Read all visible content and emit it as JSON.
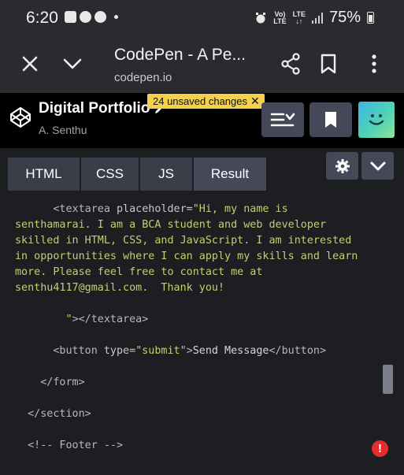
{
  "status_bar": {
    "time": "6:20",
    "network_top": "Vo)",
    "network_bottom": "LTE",
    "lte_top": "LTE",
    "lte_bottom": "↓↑",
    "battery": "75%",
    "left_icons": [
      "image-icon",
      "media-icon",
      "game-icon"
    ],
    "right_icons": [
      "alarm-icon",
      "signal-icon",
      "battery-icon"
    ]
  },
  "browser": {
    "title": "CodePen - A Pe...",
    "url": "codepen.io",
    "icons": [
      "close-icon",
      "chevron-down-icon",
      "share-icon",
      "bookmark-icon",
      "more-vert-icon"
    ]
  },
  "codepen": {
    "title": "Digital Portfolio",
    "author": "A. Senthu",
    "unsaved_badge": "24 unsaved changes",
    "unsaved_close": "✕",
    "icons": [
      "codepen-logo-icon",
      "edit-pencil-icon",
      "layout-icon",
      "bookmark-icon",
      "avatar-face-icon"
    ],
    "accent": "#f5d04a"
  },
  "tabs": [
    "HTML",
    "CSS",
    "JS",
    "Result"
  ],
  "active_tab": "Result",
  "tool_icons": [
    "gear-icon",
    "chevron-down-icon"
  ],
  "code_lines": [
    {
      "parts": [
        {
          "cls": "tag",
          "t": "      <textarea "
        },
        {
          "cls": "attr",
          "t": "placeholder="
        },
        {
          "cls": "str",
          "t": "\"Hi, my name is"
        }
      ]
    },
    {
      "parts": [
        {
          "cls": "str",
          "t": "senthamarai. I am a BCA student and web developer"
        }
      ]
    },
    {
      "parts": [
        {
          "cls": "str",
          "t": "skilled in HTML, CSS, and JavaScript. I am interested"
        }
      ]
    },
    {
      "parts": [
        {
          "cls": "str",
          "t": "in opportunities where I can apply my skills and learn"
        }
      ]
    },
    {
      "parts": [
        {
          "cls": "str",
          "t": "more. Please feel free to contact me at"
        }
      ]
    },
    {
      "parts": [
        {
          "cls": "str",
          "t": "senthu4117@gmail.com.  Thank you!"
        }
      ]
    },
    {
      "parts": [
        {
          "cls": "txt",
          "t": ""
        }
      ]
    },
    {
      "parts": [
        {
          "cls": "str",
          "t": "        \""
        },
        {
          "cls": "tag",
          "t": "></textarea>"
        }
      ]
    },
    {
      "parts": [
        {
          "cls": "txt",
          "t": ""
        }
      ]
    },
    {
      "parts": [
        {
          "cls": "tag",
          "t": "      <button "
        },
        {
          "cls": "attr",
          "t": "type="
        },
        {
          "cls": "str",
          "t": "\"submit\""
        },
        {
          "cls": "tag",
          "t": ">"
        },
        {
          "cls": "txt",
          "t": "Send Message"
        },
        {
          "cls": "tag",
          "t": "</button>"
        }
      ]
    },
    {
      "parts": [
        {
          "cls": "txt",
          "t": ""
        }
      ]
    },
    {
      "parts": [
        {
          "cls": "tag",
          "t": "    </form>"
        }
      ]
    },
    {
      "parts": [
        {
          "cls": "txt",
          "t": ""
        }
      ]
    },
    {
      "parts": [
        {
          "cls": "tag",
          "t": "  </section>"
        }
      ]
    },
    {
      "parts": [
        {
          "cls": "txt",
          "t": ""
        }
      ]
    },
    {
      "parts": [
        {
          "cls": "tag",
          "t": "  <!-- Footer -->"
        }
      ]
    }
  ],
  "error_mark": "!",
  "colors": {
    "background": "#1d1e22",
    "header": "#2a2b2f",
    "button": "#444857",
    "string": "#c6cd72",
    "error": "#e62d2d"
  }
}
